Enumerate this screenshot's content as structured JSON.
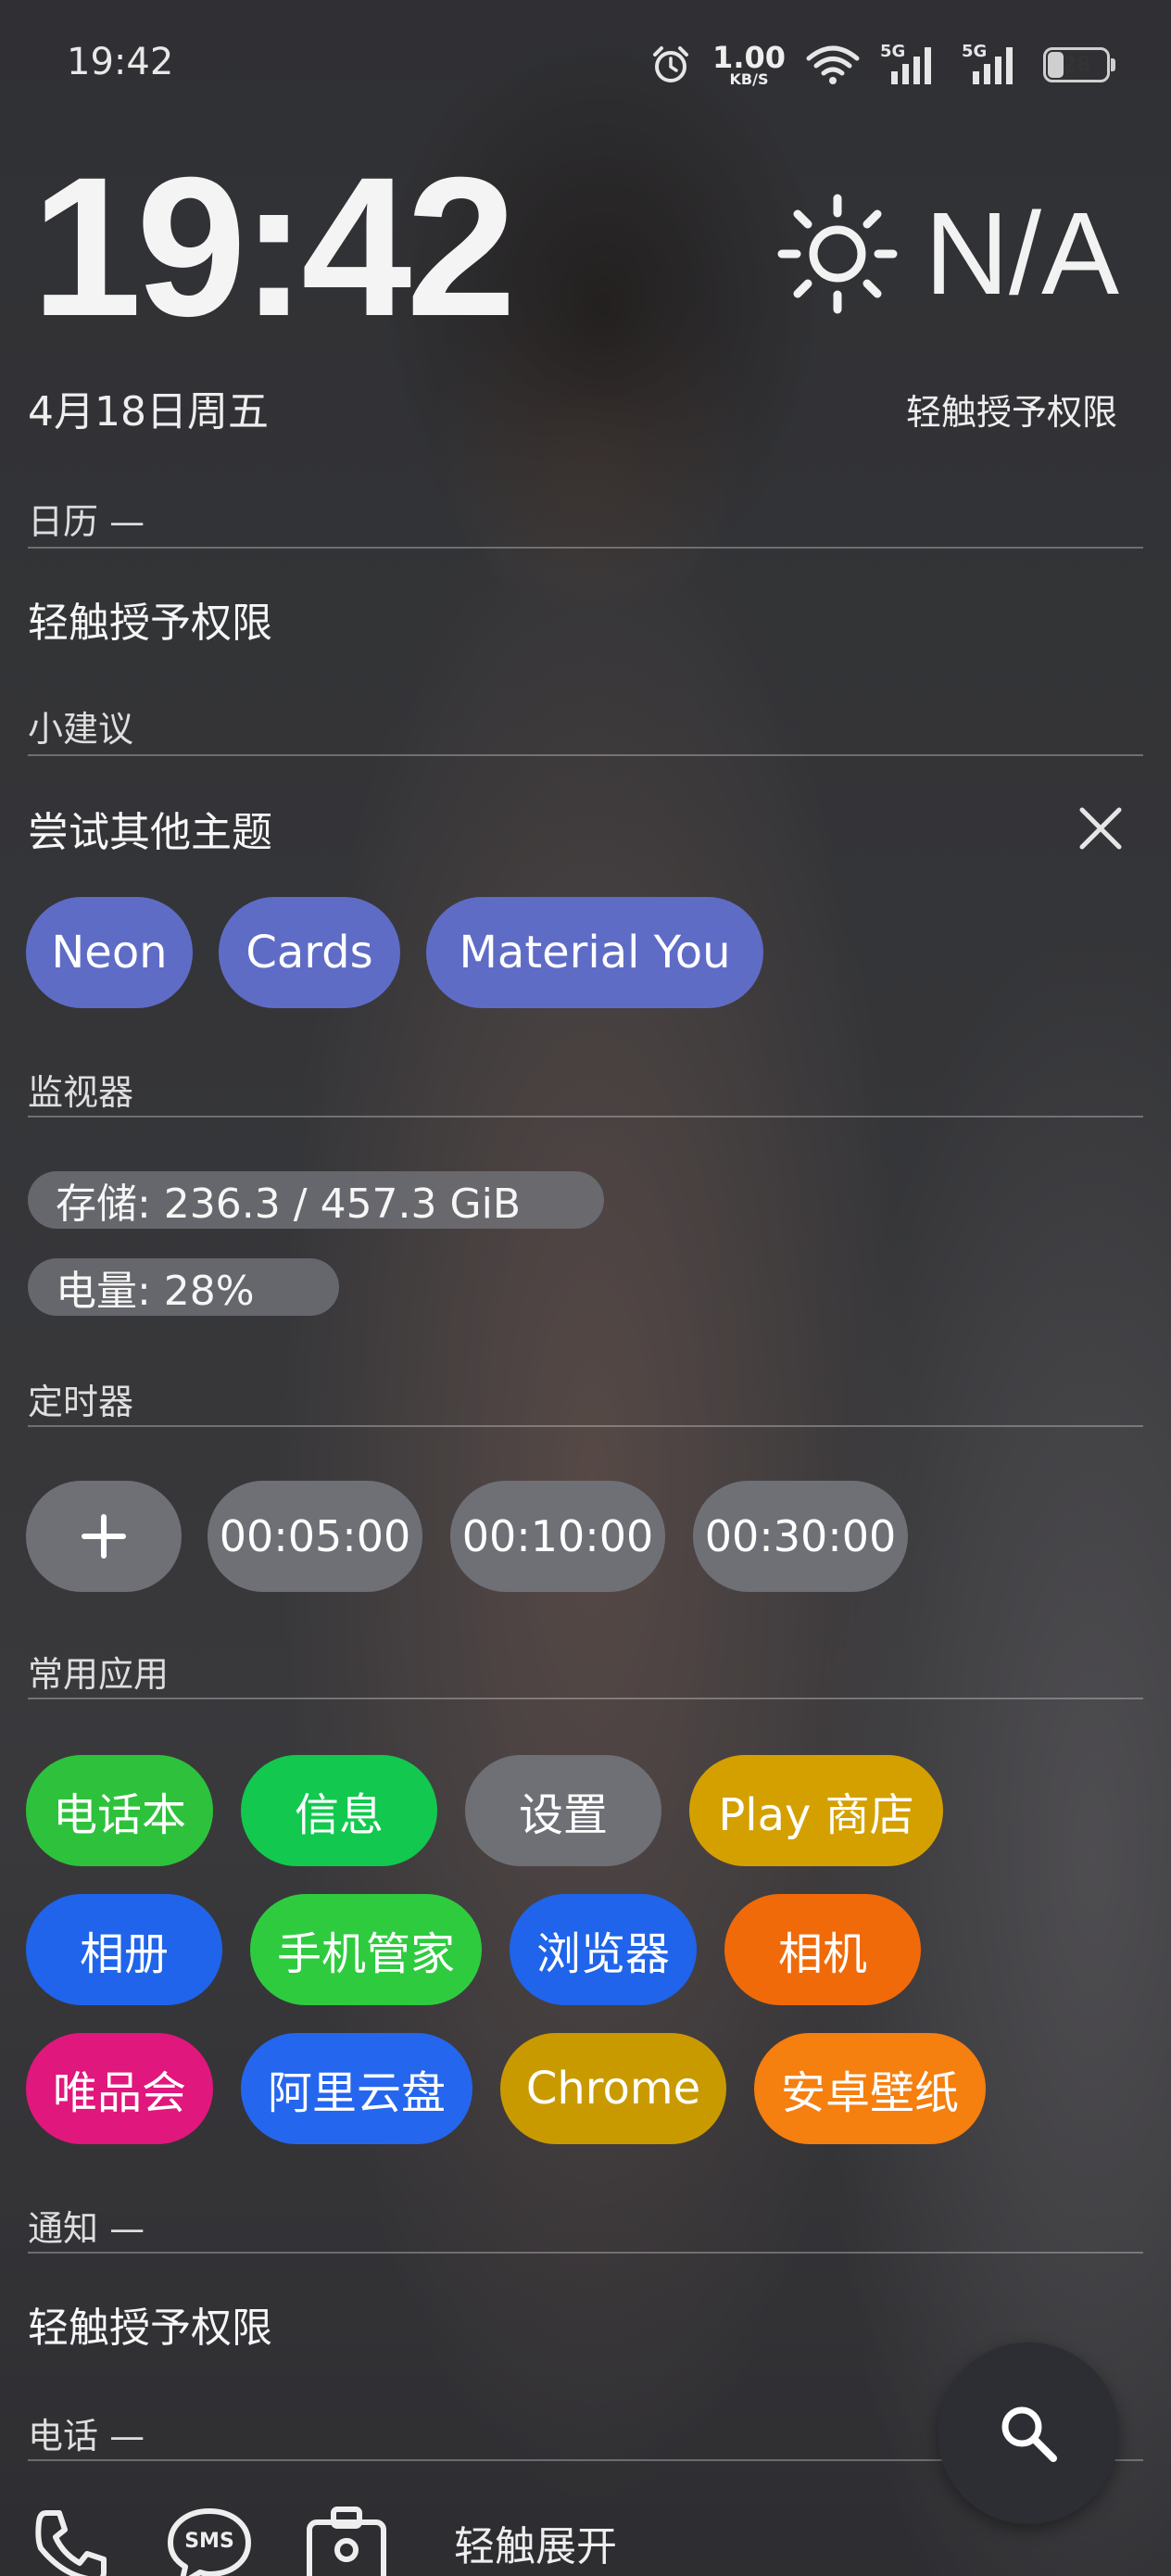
{
  "status_bar": {
    "time": "19:42",
    "net_speed_value": "1.00",
    "net_speed_unit": "KB/S",
    "signal_label_1": "5G",
    "signal_label_2": "5G",
    "battery_percent": "28",
    "battery_level": 0.28,
    "icons": [
      "alarm-icon",
      "wifi-icon",
      "signal-5g-icon",
      "signal-5g-icon",
      "battery-icon"
    ]
  },
  "header": {
    "clock": "19:42",
    "weather_temp": "N/A",
    "weather_icon": "sun-icon",
    "date": "4月18日周五",
    "weather_permission": "轻触授予权限"
  },
  "calendar": {
    "title": "日历 —",
    "message": "轻触授予权限"
  },
  "suggestions": {
    "title": "小建议",
    "heading": "尝试其他主题",
    "close_icon": "close-icon",
    "themes": [
      "Neon",
      "Cards",
      "Material You"
    ],
    "chip_color": "#5f6cc6"
  },
  "monitor": {
    "title": "监视器",
    "storage": "存储: 236.3 / 457.3 GiB",
    "battery": "电量: 28%"
  },
  "timer": {
    "title": "定时器",
    "add_icon": "plus-icon",
    "presets": [
      "00:05:00",
      "00:10:00",
      "00:30:00"
    ]
  },
  "apps": {
    "title": "常用应用",
    "items": [
      {
        "label": "电话本",
        "color": "#2ec23c"
      },
      {
        "label": "信息",
        "color": "#12c84f"
      },
      {
        "label": "设置",
        "color": "#6e7076"
      },
      {
        "label": "Play 商店",
        "color": "#d4a000"
      },
      {
        "label": "相册",
        "color": "#1f64ea"
      },
      {
        "label": "手机管家",
        "color": "#2ecb3f"
      },
      {
        "label": "浏览器",
        "color": "#1f64ea"
      },
      {
        "label": "相机",
        "color": "#f06a0a"
      },
      {
        "label": "唯品会",
        "color": "#e0177d"
      },
      {
        "label": "阿里云盘",
        "color": "#2566ee"
      },
      {
        "label": "Chrome",
        "color": "#c99a00"
      },
      {
        "label": "安卓壁纸",
        "color": "#f57f0f"
      }
    ]
  },
  "notifications": {
    "title": "通知 —",
    "message": "轻触授予权限"
  },
  "phone": {
    "title": "电话 —",
    "expand": "轻触展开",
    "icons": [
      "phone-icon",
      "sms-icon",
      "contacts-icon"
    ],
    "sms_label": "SMS"
  },
  "search": {
    "icon": "search-icon"
  }
}
